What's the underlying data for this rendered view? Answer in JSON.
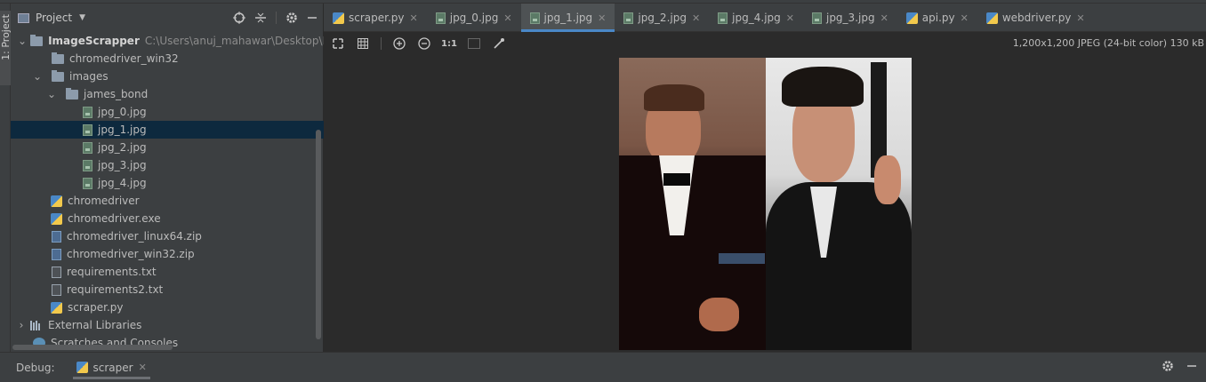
{
  "sidebar_tab": {
    "label": "1: Project"
  },
  "project_panel": {
    "title": "Project",
    "tree": [
      {
        "label": "ImageScrapper",
        "path": "C:\\Users\\anuj_mahawar\\Desktop\\Python",
        "icon": "folder-icon",
        "depth": 0
      },
      {
        "label": "chromedriver_win32",
        "icon": "folder-icon",
        "depth": 1
      },
      {
        "label": "images",
        "icon": "folder-icon",
        "depth": 1
      },
      {
        "label": "james_bond",
        "icon": "folder-icon",
        "depth": 2
      },
      {
        "label": "jpg_0.jpg",
        "icon": "image-file-icon",
        "depth": 3
      },
      {
        "label": "jpg_1.jpg",
        "icon": "image-file-icon",
        "depth": 3,
        "selected": true
      },
      {
        "label": "jpg_2.jpg",
        "icon": "image-file-icon",
        "depth": 3
      },
      {
        "label": "jpg_3.jpg",
        "icon": "image-file-icon",
        "depth": 3
      },
      {
        "label": "jpg_4.jpg",
        "icon": "image-file-icon",
        "depth": 3
      },
      {
        "label": "chromedriver",
        "icon": "python-file-icon",
        "depth": 1
      },
      {
        "label": "chromedriver.exe",
        "icon": "python-file-icon",
        "depth": 1
      },
      {
        "label": "chromedriver_linux64.zip",
        "icon": "zip-file-icon",
        "depth": 1
      },
      {
        "label": "chromedriver_win32.zip",
        "icon": "zip-file-icon",
        "depth": 1
      },
      {
        "label": "requirements.txt",
        "icon": "text-file-icon",
        "depth": 1
      },
      {
        "label": "requirements2.txt",
        "icon": "text-file-icon",
        "depth": 1
      },
      {
        "label": "scraper.py",
        "icon": "python-file-icon",
        "depth": 1
      },
      {
        "label": "External Libraries",
        "icon": "library-icon",
        "depth": 0
      },
      {
        "label": "Scratches and Consoles",
        "icon": "scratch-icon",
        "depth": 0
      }
    ]
  },
  "editor_tabs": [
    {
      "label": "scraper.py",
      "icon": "python-file-icon"
    },
    {
      "label": "jpg_0.jpg",
      "icon": "image-file-icon"
    },
    {
      "label": "jpg_1.jpg",
      "icon": "image-file-icon",
      "active": true
    },
    {
      "label": "jpg_2.jpg",
      "icon": "image-file-icon"
    },
    {
      "label": "jpg_4.jpg",
      "icon": "image-file-icon"
    },
    {
      "label": "jpg_3.jpg",
      "icon": "image-file-icon"
    },
    {
      "label": "api.py",
      "icon": "python-file-icon"
    },
    {
      "label": "webdriver.py",
      "icon": "python-file-icon"
    }
  ],
  "image_toolbar": {
    "actual_size_label": "1:1"
  },
  "image_info": "1,200x1,200 JPEG (24-bit color) 130 kB",
  "debug": {
    "label": "Debug:",
    "tab": "scraper"
  },
  "colors": {
    "accent": "#4a88c7",
    "selection": "#0d293e",
    "panel": "#3c3f41",
    "editor": "#2b2b2b"
  }
}
